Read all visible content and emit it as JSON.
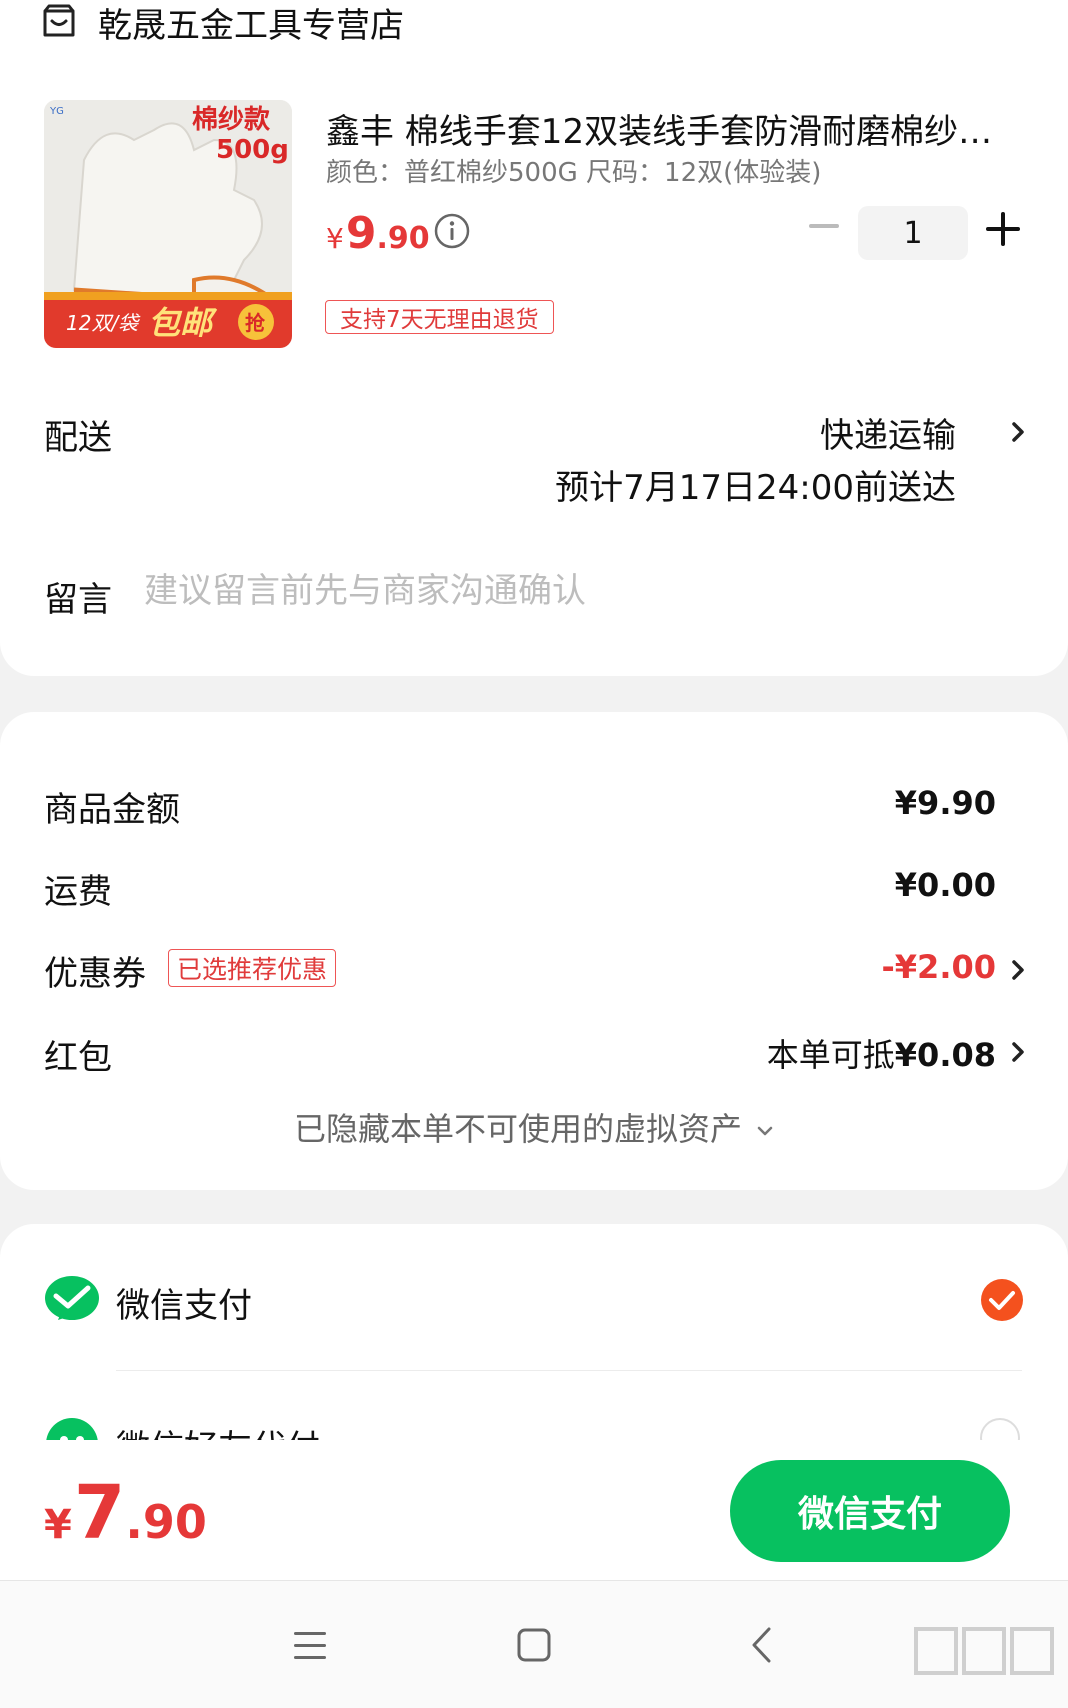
{
  "store": {
    "name": "乾晟五金工具专营店"
  },
  "product": {
    "image": {
      "badge_top_line1": "棉纱款",
      "badge_top_line2": "500g",
      "badge_bottom_count": "12双/袋",
      "badge_bottom_label": "包邮",
      "badge_bottom_action": "抢"
    },
    "title": "鑫丰 棉线手套12双装线手套防滑耐磨棉纱…",
    "spec": "颜色：普红棉纱500G   尺码：12双(体验装)",
    "price": {
      "symbol": "¥",
      "integer": "9",
      "decimal": ".90"
    },
    "quantity": "1",
    "return_tag": "支持7天无理由退货"
  },
  "delivery": {
    "label": "配送",
    "method": "快递运输",
    "eta": "预计7月17日24:00前送达"
  },
  "message": {
    "label": "留言",
    "placeholder": "建议留言前先与商家沟通确认"
  },
  "summary": {
    "goods_label": "商品金额",
    "goods_value": "¥9.90",
    "shipping_label": "运费",
    "shipping_value": "¥0.00",
    "coupon_label": "优惠券",
    "coupon_tag": "已选推荐优惠",
    "coupon_value": "-¥2.00",
    "redpack_label": "红包",
    "redpack_prefix": "本单可抵",
    "redpack_value": "¥0.08",
    "hidden_assets": "已隐藏本单不可使用的虚拟资产"
  },
  "payment": {
    "wechat_pay": "微信支付",
    "friend_pay": "微信好友代付"
  },
  "bottom": {
    "total_symbol": "¥",
    "total_integer": "7",
    "total_decimal": ".90",
    "pay_button": "微信支付"
  },
  "colors": {
    "accent_red": "#e53838",
    "wechat_green": "#07c160",
    "check_orange": "#f4511e"
  },
  "icons": [
    "store-icon",
    "info-icon",
    "chevron-right-icon",
    "chevron-down-icon",
    "wechat-pay-icon",
    "check-icon",
    "friend-pay-icon",
    "menu-icon",
    "home-icon",
    "back-icon"
  ]
}
